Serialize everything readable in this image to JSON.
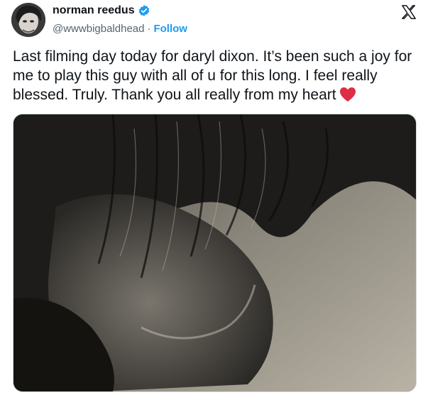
{
  "author": {
    "display_name": "norman reedus",
    "handle": "@wwwbigbaldhead",
    "separator": "·",
    "follow_label": "Follow",
    "verified": true
  },
  "tweet": {
    "text": "Last filming day today for daryl dixon. It’s been such a joy for me to play this guy with all of u for this long. I feel really blessed. Truly. Thank you all really from my heart",
    "emoji": "red-heart-icon"
  },
  "icons": {
    "brand": "x-logo-icon",
    "verified": "verified-badge-icon",
    "accent": "#1d9bf0"
  }
}
